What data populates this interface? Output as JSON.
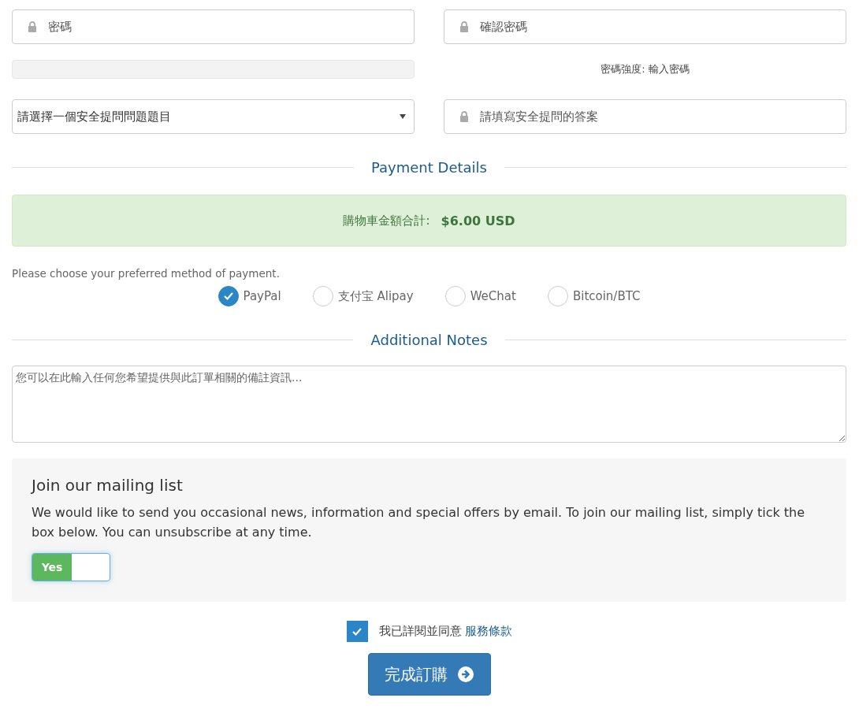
{
  "account": {
    "password": {
      "placeholder": "密碼"
    },
    "confirm_password": {
      "placeholder": "確認密碼"
    },
    "strength_text": "密碼強度: 輸入密碼",
    "security_question": {
      "value": "請選擇一個安全提問問題題目"
    },
    "security_answer": {
      "placeholder": "請填寫安全提問的答案"
    }
  },
  "payment": {
    "heading": "Payment Details",
    "total_label": "購物車金額合計:",
    "total_value": "$6.00 USD",
    "prompt": "Please choose your preferred method of payment.",
    "methods": [
      {
        "label": "PayPal",
        "selected": true
      },
      {
        "label": "支付宝 Alipay",
        "selected": false
      },
      {
        "label": "WeChat",
        "selected": false
      },
      {
        "label": "Bitcoin/BTC",
        "selected": false
      }
    ]
  },
  "notes": {
    "heading": "Additional Notes",
    "placeholder": "您可以在此輸入任何您希望提供與此訂單相關的備註資訊..."
  },
  "mailing": {
    "title": "Join our mailing list",
    "text": "We would like to send you occasional news, information and special offers by email. To join our mailing list, simply tick the box below. You can unsubscribe at any time.",
    "toggle_label": "Yes",
    "on": true
  },
  "terms": {
    "checked": true,
    "text": "我已詳閱並同意",
    "link": "服務條款"
  },
  "submit": "完成訂購"
}
